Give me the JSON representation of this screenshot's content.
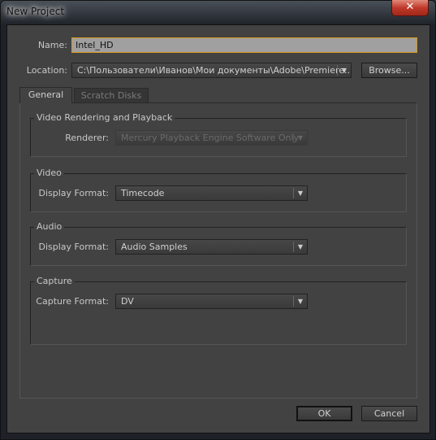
{
  "window": {
    "title": "New Project",
    "close_icon": "close-icon"
  },
  "name": {
    "label": "Name:",
    "value": "Intel_HD"
  },
  "location": {
    "label": "Location:",
    "value": "C:\\Пользователи\\Иванов\\Мои документы\\Adobe\\Premiere...",
    "browse": "Browse..."
  },
  "tabs": [
    {
      "label": "General",
      "active": true
    },
    {
      "label": "Scratch Disks",
      "active": false
    }
  ],
  "groups": {
    "rendering": {
      "title": "Video Rendering and Playback",
      "label": "Renderer:",
      "value": "Mercury Playback Engine Software Only",
      "disabled": true
    },
    "video": {
      "title": "Video",
      "label": "Display Format:",
      "value": "Timecode"
    },
    "audio": {
      "title": "Audio",
      "label": "Display Format:",
      "value": "Audio Samples"
    },
    "capture": {
      "title": "Capture",
      "label": "Capture Format:",
      "value": "DV"
    }
  },
  "buttons": {
    "ok": "OK",
    "cancel": "Cancel"
  },
  "colors": {
    "focus_border": "#d89a1a",
    "dialog_bg": "#424242"
  }
}
